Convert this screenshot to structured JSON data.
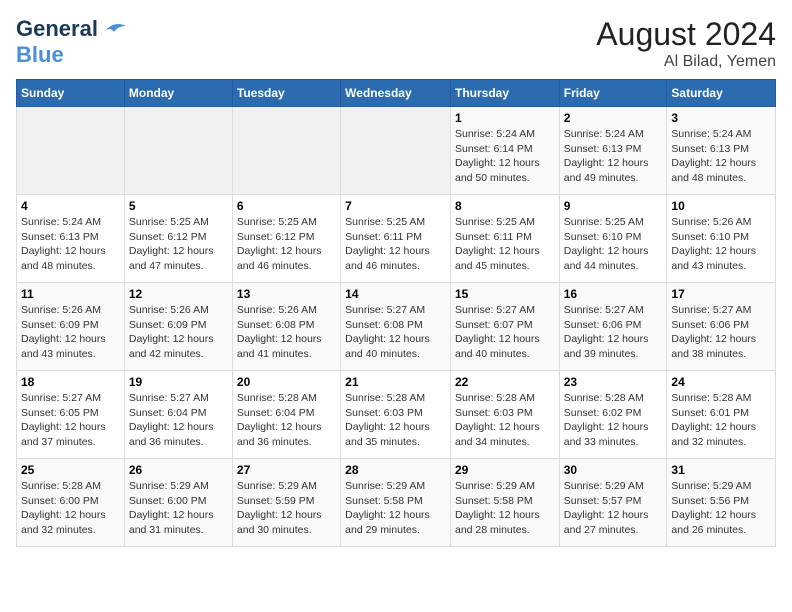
{
  "logo": {
    "line1": "General",
    "line2": "Blue"
  },
  "title": "August 2024",
  "subtitle": "Al Bilad, Yemen",
  "days_of_week": [
    "Sunday",
    "Monday",
    "Tuesday",
    "Wednesday",
    "Thursday",
    "Friday",
    "Saturday"
  ],
  "weeks": [
    [
      {
        "day": "",
        "sunrise": "",
        "sunset": "",
        "daylight": ""
      },
      {
        "day": "",
        "sunrise": "",
        "sunset": "",
        "daylight": ""
      },
      {
        "day": "",
        "sunrise": "",
        "sunset": "",
        "daylight": ""
      },
      {
        "day": "",
        "sunrise": "",
        "sunset": "",
        "daylight": ""
      },
      {
        "day": "1",
        "sunrise": "Sunrise: 5:24 AM",
        "sunset": "Sunset: 6:14 PM",
        "daylight": "Daylight: 12 hours and 50 minutes."
      },
      {
        "day": "2",
        "sunrise": "Sunrise: 5:24 AM",
        "sunset": "Sunset: 6:13 PM",
        "daylight": "Daylight: 12 hours and 49 minutes."
      },
      {
        "day": "3",
        "sunrise": "Sunrise: 5:24 AM",
        "sunset": "Sunset: 6:13 PM",
        "daylight": "Daylight: 12 hours and 48 minutes."
      }
    ],
    [
      {
        "day": "4",
        "sunrise": "Sunrise: 5:24 AM",
        "sunset": "Sunset: 6:13 PM",
        "daylight": "Daylight: 12 hours and 48 minutes."
      },
      {
        "day": "5",
        "sunrise": "Sunrise: 5:25 AM",
        "sunset": "Sunset: 6:12 PM",
        "daylight": "Daylight: 12 hours and 47 minutes."
      },
      {
        "day": "6",
        "sunrise": "Sunrise: 5:25 AM",
        "sunset": "Sunset: 6:12 PM",
        "daylight": "Daylight: 12 hours and 46 minutes."
      },
      {
        "day": "7",
        "sunrise": "Sunrise: 5:25 AM",
        "sunset": "Sunset: 6:11 PM",
        "daylight": "Daylight: 12 hours and 46 minutes."
      },
      {
        "day": "8",
        "sunrise": "Sunrise: 5:25 AM",
        "sunset": "Sunset: 6:11 PM",
        "daylight": "Daylight: 12 hours and 45 minutes."
      },
      {
        "day": "9",
        "sunrise": "Sunrise: 5:25 AM",
        "sunset": "Sunset: 6:10 PM",
        "daylight": "Daylight: 12 hours and 44 minutes."
      },
      {
        "day": "10",
        "sunrise": "Sunrise: 5:26 AM",
        "sunset": "Sunset: 6:10 PM",
        "daylight": "Daylight: 12 hours and 43 minutes."
      }
    ],
    [
      {
        "day": "11",
        "sunrise": "Sunrise: 5:26 AM",
        "sunset": "Sunset: 6:09 PM",
        "daylight": "Daylight: 12 hours and 43 minutes."
      },
      {
        "day": "12",
        "sunrise": "Sunrise: 5:26 AM",
        "sunset": "Sunset: 6:09 PM",
        "daylight": "Daylight: 12 hours and 42 minutes."
      },
      {
        "day": "13",
        "sunrise": "Sunrise: 5:26 AM",
        "sunset": "Sunset: 6:08 PM",
        "daylight": "Daylight: 12 hours and 41 minutes."
      },
      {
        "day": "14",
        "sunrise": "Sunrise: 5:27 AM",
        "sunset": "Sunset: 6:08 PM",
        "daylight": "Daylight: 12 hours and 40 minutes."
      },
      {
        "day": "15",
        "sunrise": "Sunrise: 5:27 AM",
        "sunset": "Sunset: 6:07 PM",
        "daylight": "Daylight: 12 hours and 40 minutes."
      },
      {
        "day": "16",
        "sunrise": "Sunrise: 5:27 AM",
        "sunset": "Sunset: 6:06 PM",
        "daylight": "Daylight: 12 hours and 39 minutes."
      },
      {
        "day": "17",
        "sunrise": "Sunrise: 5:27 AM",
        "sunset": "Sunset: 6:06 PM",
        "daylight": "Daylight: 12 hours and 38 minutes."
      }
    ],
    [
      {
        "day": "18",
        "sunrise": "Sunrise: 5:27 AM",
        "sunset": "Sunset: 6:05 PM",
        "daylight": "Daylight: 12 hours and 37 minutes."
      },
      {
        "day": "19",
        "sunrise": "Sunrise: 5:27 AM",
        "sunset": "Sunset: 6:04 PM",
        "daylight": "Daylight: 12 hours and 36 minutes."
      },
      {
        "day": "20",
        "sunrise": "Sunrise: 5:28 AM",
        "sunset": "Sunset: 6:04 PM",
        "daylight": "Daylight: 12 hours and 36 minutes."
      },
      {
        "day": "21",
        "sunrise": "Sunrise: 5:28 AM",
        "sunset": "Sunset: 6:03 PM",
        "daylight": "Daylight: 12 hours and 35 minutes."
      },
      {
        "day": "22",
        "sunrise": "Sunrise: 5:28 AM",
        "sunset": "Sunset: 6:03 PM",
        "daylight": "Daylight: 12 hours and 34 minutes."
      },
      {
        "day": "23",
        "sunrise": "Sunrise: 5:28 AM",
        "sunset": "Sunset: 6:02 PM",
        "daylight": "Daylight: 12 hours and 33 minutes."
      },
      {
        "day": "24",
        "sunrise": "Sunrise: 5:28 AM",
        "sunset": "Sunset: 6:01 PM",
        "daylight": "Daylight: 12 hours and 32 minutes."
      }
    ],
    [
      {
        "day": "25",
        "sunrise": "Sunrise: 5:28 AM",
        "sunset": "Sunset: 6:00 PM",
        "daylight": "Daylight: 12 hours and 32 minutes."
      },
      {
        "day": "26",
        "sunrise": "Sunrise: 5:29 AM",
        "sunset": "Sunset: 6:00 PM",
        "daylight": "Daylight: 12 hours and 31 minutes."
      },
      {
        "day": "27",
        "sunrise": "Sunrise: 5:29 AM",
        "sunset": "Sunset: 5:59 PM",
        "daylight": "Daylight: 12 hours and 30 minutes."
      },
      {
        "day": "28",
        "sunrise": "Sunrise: 5:29 AM",
        "sunset": "Sunset: 5:58 PM",
        "daylight": "Daylight: 12 hours and 29 minutes."
      },
      {
        "day": "29",
        "sunrise": "Sunrise: 5:29 AM",
        "sunset": "Sunset: 5:58 PM",
        "daylight": "Daylight: 12 hours and 28 minutes."
      },
      {
        "day": "30",
        "sunrise": "Sunrise: 5:29 AM",
        "sunset": "Sunset: 5:57 PM",
        "daylight": "Daylight: 12 hours and 27 minutes."
      },
      {
        "day": "31",
        "sunrise": "Sunrise: 5:29 AM",
        "sunset": "Sunset: 5:56 PM",
        "daylight": "Daylight: 12 hours and 26 minutes."
      }
    ]
  ]
}
